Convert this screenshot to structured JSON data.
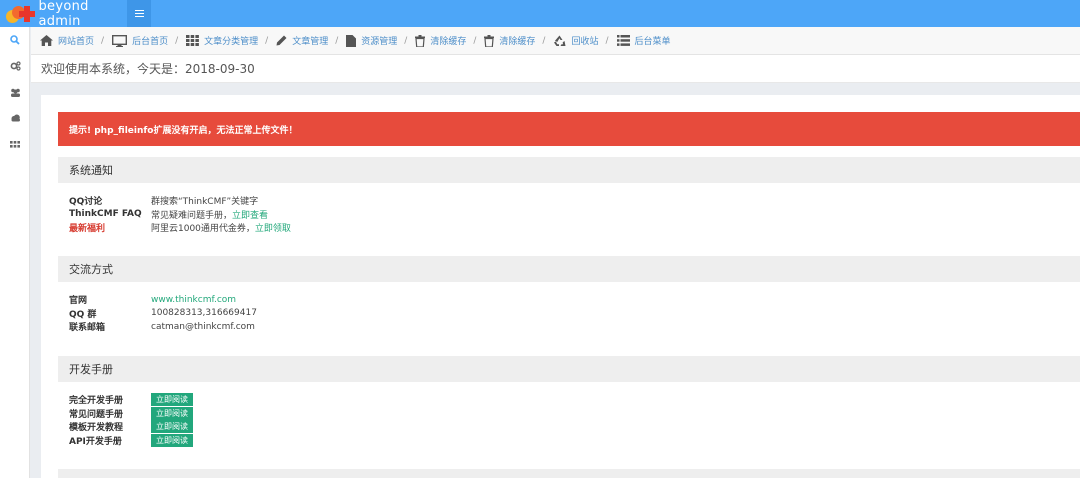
{
  "app": {
    "brand": "beyond admin"
  },
  "breadcrumb": [
    {
      "label": "网站首页",
      "icon": "home-icon"
    },
    {
      "label": "后台首页",
      "icon": "monitor-icon"
    },
    {
      "label": "文章分类管理",
      "icon": "grid-icon"
    },
    {
      "label": "文章管理",
      "icon": "pencil-icon"
    },
    {
      "label": "资源管理",
      "icon": "file-icon"
    },
    {
      "label": "清除缓存",
      "icon": "trash-icon"
    },
    {
      "label": "清除缓存",
      "icon": "trash-icon"
    },
    {
      "label": "回收站",
      "icon": "recycle-icon"
    },
    {
      "label": "后台菜单",
      "icon": "list-icon"
    }
  ],
  "breadcrumb_separator": "/",
  "sidebar": [
    {
      "icon": "search-icon"
    },
    {
      "icon": "gears-icon"
    },
    {
      "icon": "users-icon"
    },
    {
      "icon": "cloud-icon"
    },
    {
      "icon": "apps-icon"
    }
  ],
  "page": {
    "welcome": "欢迎使用本系统，今天是：2018-09-30"
  },
  "alert": {
    "text": "提示! php_fileinfo扩展没有开启，无法正常上传文件！"
  },
  "notice": {
    "title": "系统通知",
    "qq_label": "QQ讨论",
    "qq_value": "群搜索“ThinkCMF”关键字",
    "faq_label": "ThinkCMF FAQ",
    "faq_value": "常见疑难问题手册，",
    "faq_link": "立即查看",
    "welfare_label": "最新福利",
    "welfare_value": "阿里云1000通用代金券，",
    "welfare_link": "立即领取"
  },
  "contact": {
    "title": "交流方式",
    "site_label": "官网",
    "site_value": "www.thinkcmf.com",
    "qq_label": "QQ 群",
    "qq_value": "100828313,316669417",
    "email_label": "联系邮箱",
    "email_value": "catman@thinkcmf.com"
  },
  "manuals": {
    "title": "开发手册",
    "items": [
      {
        "label": "完全开发手册",
        "action": "立即阅读"
      },
      {
        "label": "常见问题手册",
        "action": "立即阅读"
      },
      {
        "label": "模板开发教程",
        "action": "立即阅读"
      },
      {
        "label": "API开发手册",
        "action": "立即阅读"
      }
    ]
  },
  "colors": {
    "navbar": "#4da6f8",
    "alert": "#e74b3c",
    "link": "#23a87b",
    "badge": "#22a77c"
  }
}
